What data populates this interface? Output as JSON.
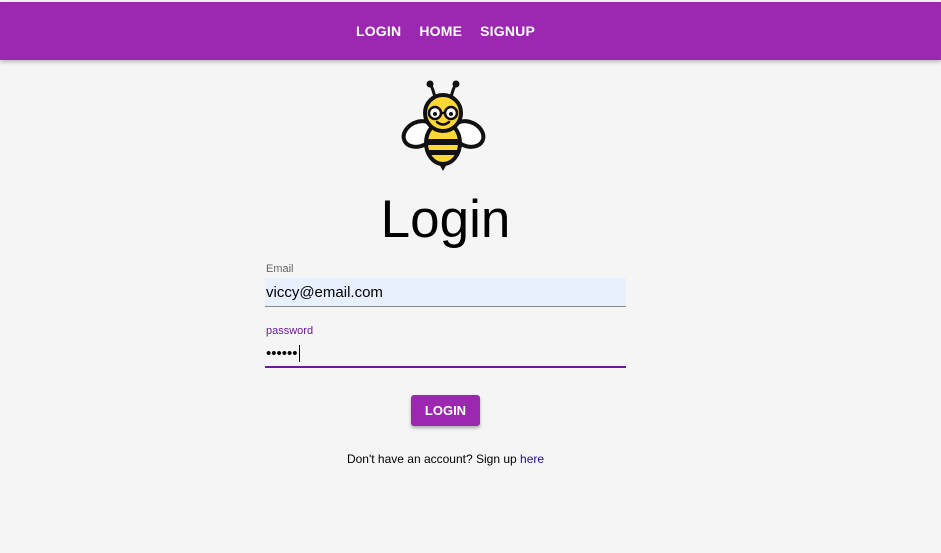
{
  "nav": {
    "items": [
      {
        "label": "LOGIN"
      },
      {
        "label": "HOME"
      },
      {
        "label": "SIGNUP"
      }
    ]
  },
  "logo": {
    "icon": "bee-icon"
  },
  "main": {
    "title": "Login"
  },
  "form": {
    "email": {
      "label": "Email",
      "value": "viccy@email.com"
    },
    "password": {
      "label": "password",
      "value": "••••••"
    },
    "submit_label": "LOGIN"
  },
  "footer": {
    "signup_prompt": "Don't have an account? Sign up",
    "signup_link": "here"
  },
  "colors": {
    "brand": "#9c27b0",
    "focus": "#6a1b9a",
    "autofill": "#e8f0fe",
    "background": "#f5f5f5"
  }
}
